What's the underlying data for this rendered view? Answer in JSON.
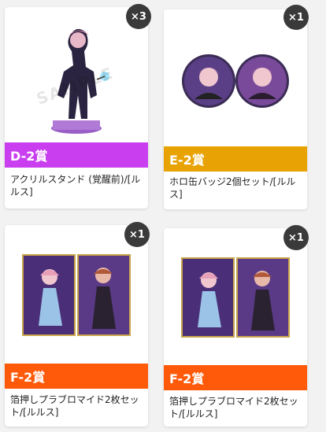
{
  "colors": {
    "d_bar": "#c93ff0",
    "e_bar": "#e8a203",
    "f_bar": "#ff5a0a",
    "badge": "#3a3a3a"
  },
  "cards": [
    {
      "prize": "D-2賞",
      "name": "アクリルスタンド (覚醒前)/[ルルス]",
      "qty": "×3",
      "watermark": "SAMPLE",
      "image": "acrylic-stand"
    },
    {
      "prize": "E-2賞",
      "name": "ホロ缶バッジ2個セット/[ルルス]",
      "qty": "×1",
      "image": "can-badges"
    },
    {
      "prize": "F-2賞",
      "name": "箔押しプラブロマイド2枚セット/[ルルス]",
      "qty": "×1",
      "image": "bromide-cards"
    },
    {
      "prize": "F-2賞",
      "name": "箔押しプラブロマイド2枚セット/[ルルス]",
      "qty": "×1",
      "image": "bromide-cards"
    }
  ]
}
